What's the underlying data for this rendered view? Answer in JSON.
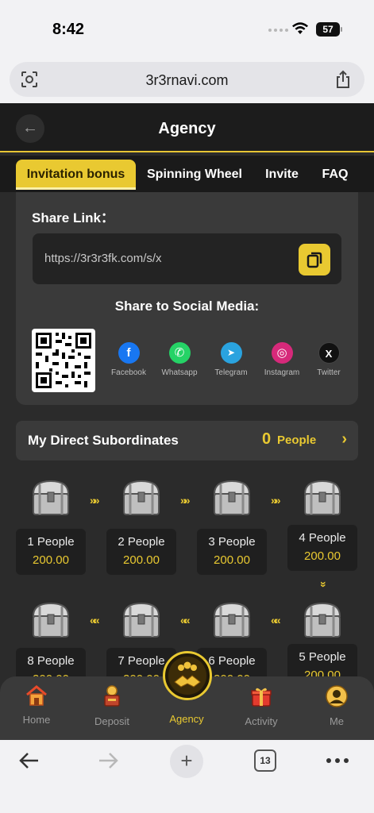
{
  "status_bar": {
    "time": "8:42",
    "battery": "57"
  },
  "browser": {
    "url": "3r3rnavi.com",
    "tab_count": "13"
  },
  "header": {
    "title": "Agency",
    "back_icon": "arrow-left-icon"
  },
  "tabs": [
    {
      "label": "Invitation bonus",
      "active": true
    },
    {
      "label": "Spinning Wheel",
      "active": false
    },
    {
      "label": "Invite",
      "active": false
    },
    {
      "label": "FAQ",
      "active": false
    }
  ],
  "share": {
    "label": "Share Link：",
    "link": "https://3r3r3fk.com/s/x",
    "social_title": "Share to Social Media:",
    "socials": [
      {
        "label": "Facebook",
        "icon": "facebook-icon",
        "color": "#1877f2",
        "glyph": "f"
      },
      {
        "label": "Whatsapp",
        "icon": "whatsapp-icon",
        "color": "#25d366",
        "glyph": "✆"
      },
      {
        "label": "Telegram",
        "icon": "telegram-icon",
        "color": "#2aa3df",
        "glyph": "➤"
      },
      {
        "label": "Instagram",
        "icon": "instagram-icon",
        "color": "#d6297a",
        "glyph": "◎"
      },
      {
        "label": "Twitter",
        "icon": "x-icon",
        "color": "#111111",
        "glyph": "X"
      }
    ]
  },
  "subordinates": {
    "title": "My Direct Subordinates",
    "count": "0",
    "unit": "People"
  },
  "levels": [
    {
      "people": "1 People",
      "reward": "200.00"
    },
    {
      "people": "2 People",
      "reward": "200.00"
    },
    {
      "people": "3 People",
      "reward": "200.00"
    },
    {
      "people": "4 People",
      "reward": "200.00"
    },
    {
      "people": "5 People",
      "reward": "200.00"
    },
    {
      "people": "6 People",
      "reward": "200.00"
    },
    {
      "people": "7 People",
      "reward": "200.00"
    },
    {
      "people": "8 People",
      "reward": "200.00"
    }
  ],
  "bottom_nav": [
    {
      "label": "Home",
      "icon": "home-icon",
      "active": false
    },
    {
      "label": "Deposit",
      "icon": "deposit-icon",
      "active": false
    },
    {
      "label": "Agency",
      "icon": "agency-icon",
      "active": true
    },
    {
      "label": "Activity",
      "icon": "gift-icon",
      "active": false
    },
    {
      "label": "Me",
      "icon": "user-icon",
      "active": false
    }
  ],
  "colors": {
    "accent": "#e9c931",
    "background": "#2b2b2b",
    "card": "#3a3a3a"
  }
}
